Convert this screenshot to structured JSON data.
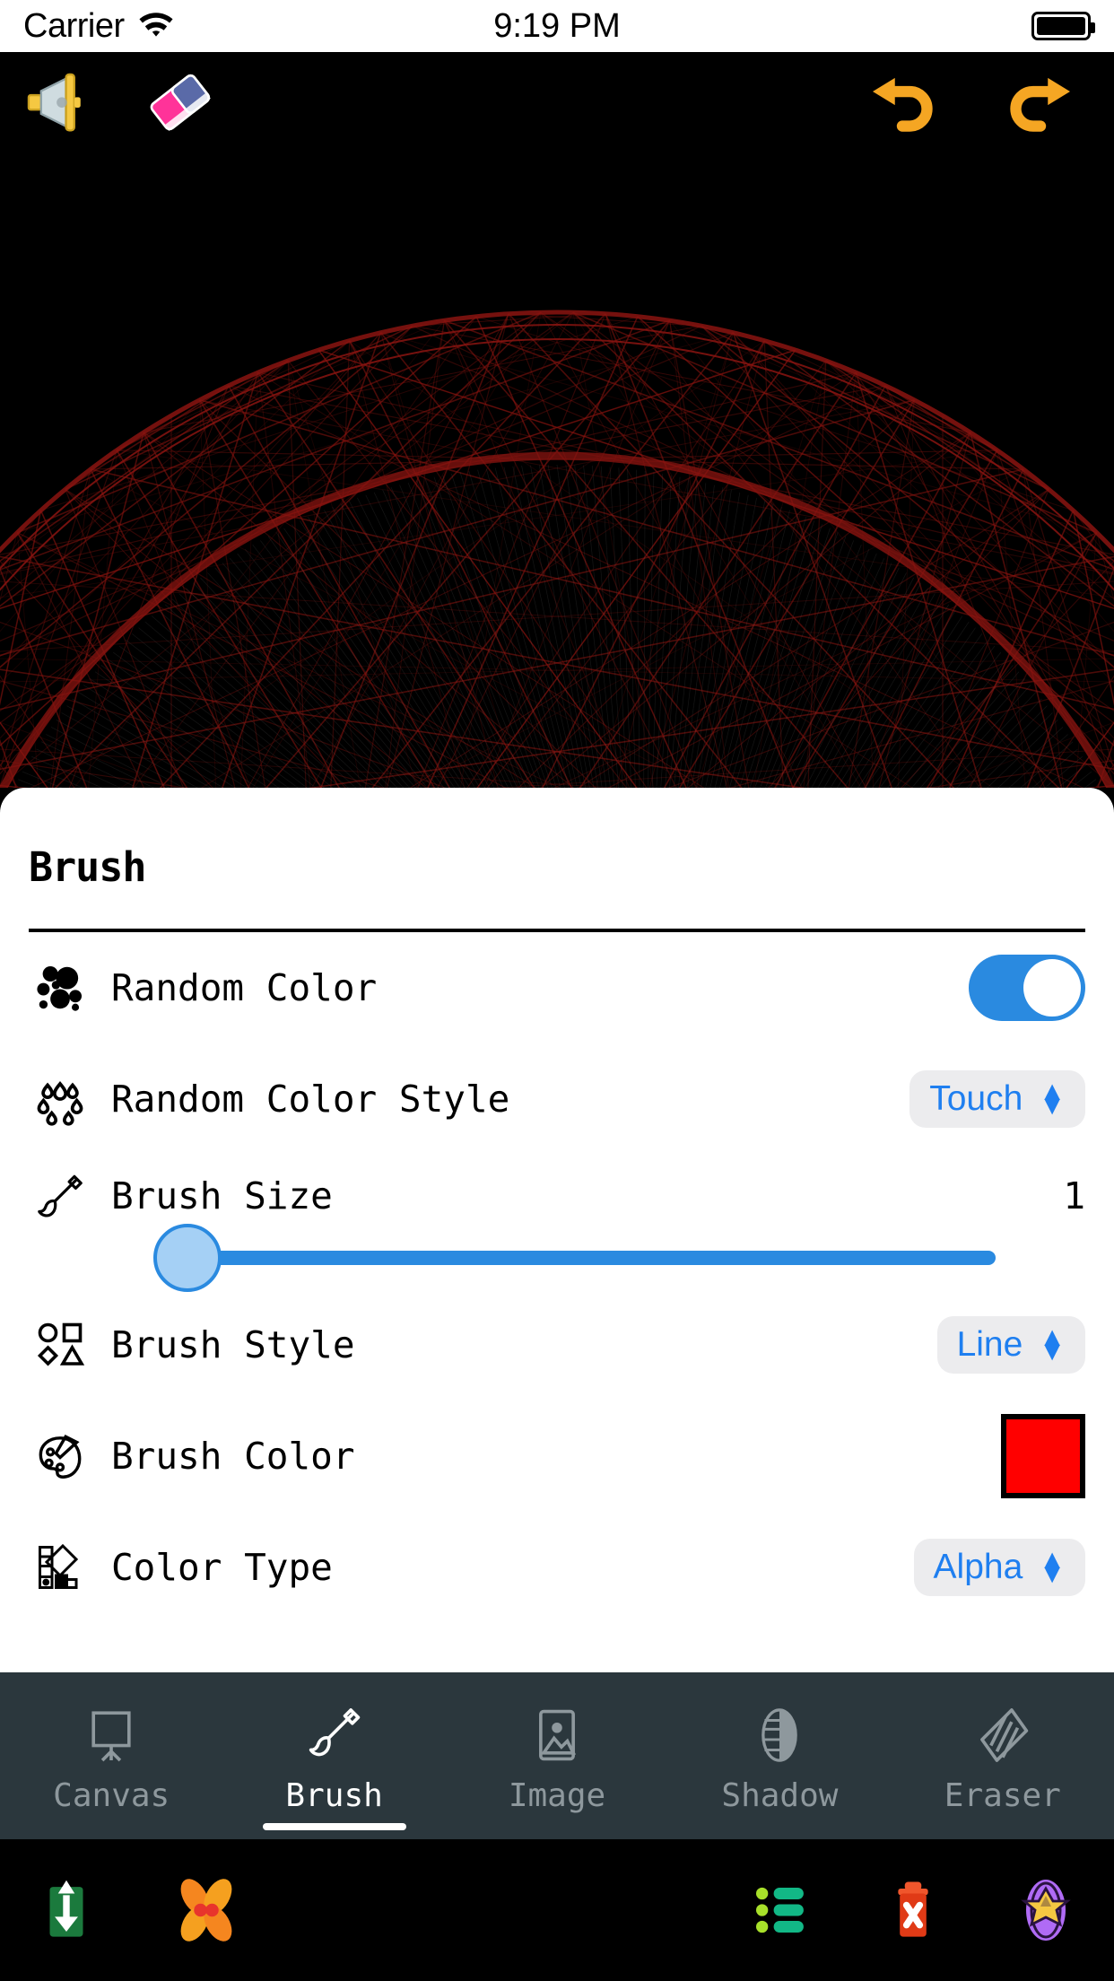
{
  "status_bar": {
    "carrier": "Carrier",
    "time": "9:19 PM",
    "wifi_icon": "wifi-icon",
    "battery_icon": "battery-full-icon"
  },
  "canvas_toolbar": {
    "items": [
      {
        "name": "megaphone-button",
        "icon": "megaphone-icon"
      },
      {
        "name": "eraser-button",
        "icon": "eraser-icon"
      },
      {
        "name": "undo-button",
        "icon": "undo-arrow-icon"
      },
      {
        "name": "redo-button",
        "icon": "redo-arrow-icon"
      }
    ]
  },
  "artwork": {
    "description": "spirograph-string-art",
    "line_color": "#8a1410",
    "background": "#000000"
  },
  "panel": {
    "title": "Brush",
    "rows": [
      {
        "icon": "dots-cluster-icon",
        "label": "Random Color",
        "control": "toggle",
        "value": "on"
      },
      {
        "icon": "droplet-flower-icon",
        "label": "Random Color Style",
        "control": "picker",
        "value": "Touch"
      },
      {
        "icon": "paintbrush-icon",
        "label": "Brush Size",
        "control": "slider",
        "value": "1",
        "slider_percent": 3
      },
      {
        "icon": "shapes-icon",
        "label": "Brush Style",
        "control": "picker",
        "value": "Line"
      },
      {
        "icon": "palette-icon",
        "label": "Brush Color",
        "control": "color-swatch",
        "value": "#FF0000"
      },
      {
        "icon": "color-swatches-icon",
        "label": "Color Type",
        "control": "picker",
        "value": "Alpha"
      }
    ]
  },
  "tab_bar": {
    "active": "Brush",
    "tabs": [
      {
        "label": "Canvas",
        "icon": "easel-icon"
      },
      {
        "label": "Brush",
        "icon": "paintbrush-icon"
      },
      {
        "label": "Image",
        "icon": "picture-icon"
      },
      {
        "label": "Shadow",
        "icon": "shadow-sphere-icon"
      },
      {
        "label": "Eraser",
        "icon": "eraser-diamond-icon"
      }
    ]
  },
  "bottom_toolbar": {
    "items": [
      {
        "name": "save-button",
        "icon": "download-arrow-icon",
        "color": "#1b7a3d"
      },
      {
        "name": "flower-button",
        "icon": "flower-icon",
        "color": "#f59a1e"
      },
      {
        "name": "list-button",
        "icon": "list-icon",
        "color": "#12b886"
      },
      {
        "name": "delete-button",
        "icon": "trash-x-icon",
        "color": "#e03a16"
      },
      {
        "name": "star-button",
        "icon": "star-badge-icon",
        "color": "#a855f7"
      }
    ]
  },
  "colors": {
    "accent_blue": "#2a8ae0",
    "picker_blue": "#1f7ff0",
    "panel_bg": "#ffffff",
    "tabbar_bg": "#2b373d",
    "brush_color": "#ff0000"
  }
}
